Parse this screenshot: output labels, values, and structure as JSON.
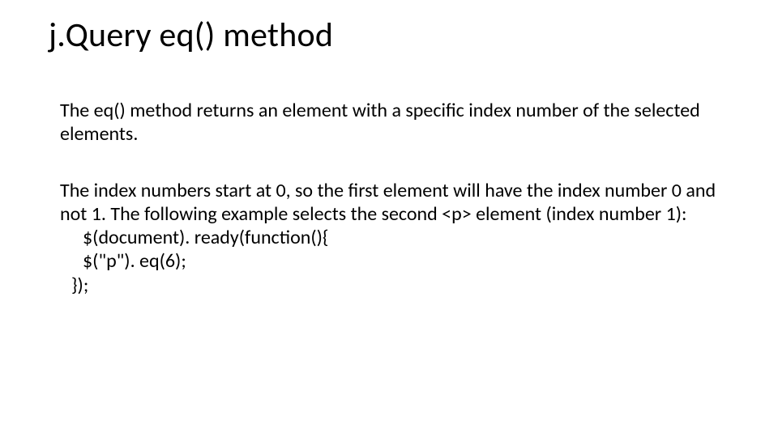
{
  "title": "j.Query eq() method",
  "para1": "The eq() method returns an element with a specific index number of the selected elements.",
  "para2": "The index numbers start at 0, so the first element will have the index number 0 and not 1. The following example selects the second <p> element (index number 1):",
  "code": {
    "line1": "$(document). ready(function(){",
    "line2": "$(\"p\"). eq(6);",
    "line3": "});"
  }
}
